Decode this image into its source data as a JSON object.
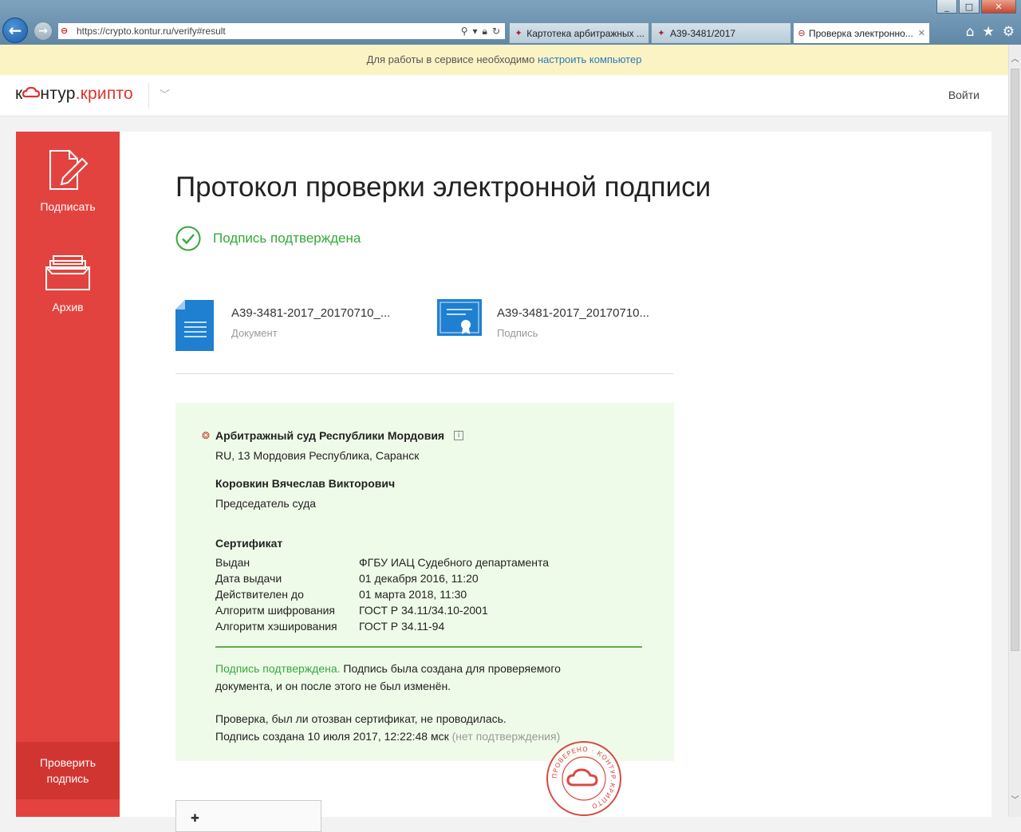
{
  "browser": {
    "url": "https://crypto.kontur.ru/verify#result",
    "tabs": [
      {
        "title": "Картотека арбитражных ...",
        "active": false
      },
      {
        "title": "А39-3481/2017",
        "active": false
      },
      {
        "title": "Проверка электронно...",
        "active": true
      }
    ],
    "window_controls": [
      "minimize",
      "maximize",
      "close"
    ]
  },
  "infobar": {
    "text": "Для работы в сервисе необходимо",
    "link": "настроить компьютер"
  },
  "header": {
    "logo_left": "к",
    "logo_mid": "нтур",
    "logo_right": ".крипто",
    "login": "Войти"
  },
  "sidebar": {
    "sign_label": "Подписать",
    "archive_label": "Архив",
    "verify_line1": "Проверить",
    "verify_line2": "подпись"
  },
  "main": {
    "title": "Протокол проверки электронной подписи",
    "status": "Подпись подтверждена",
    "files": [
      {
        "name": "А39-3481-2017_20170710_...",
        "type": "Документ",
        "icon": "document-icon"
      },
      {
        "name": "А39-3481-2017_20170710...",
        "type": "Подпись",
        "icon": "certificate-icon"
      }
    ]
  },
  "result": {
    "organization": "Арбитражный суд Республики Мордовия",
    "address": "RU, 13 Мордовия Республика, Саранск",
    "person": "Коровкин Вячеслав Викторович",
    "position": "Председатель суда",
    "certificate_title": "Сертификат",
    "certificate": [
      {
        "key": "Выдан",
        "value": "ФГБУ ИАЦ Судебного департамента"
      },
      {
        "key": "Дата выдачи",
        "value": "01 декабря 2016, 11:20"
      },
      {
        "key": "Действителен до",
        "value": "01 марта 2018, 11:30"
      },
      {
        "key": "Алгоритм шифрования",
        "value": "ГОСТ Р 34.11/34.10-2001"
      },
      {
        "key": "Алгоритм хэширования",
        "value": "ГОСТ Р 34.11-94"
      }
    ],
    "msg1_green": "Подпись подтверждена.",
    "msg1_rest": "Подпись была создана для проверяемого документа, и он после этого не был изменён.",
    "msg2": "Проверка, был ли отозван сертификат, не проводилась.",
    "msg3": "Подпись создана 10 июля 2017, 12:22:48 мск",
    "msg3_gray": "(нет подтверждения)"
  },
  "stamp": {
    "text": "ПРОВЕРЕНО · КОНТУР.КРИПТО"
  },
  "colors": {
    "accent_red": "#e3433f",
    "success_green": "#35a93b",
    "panel_bg": "#effbe9"
  }
}
